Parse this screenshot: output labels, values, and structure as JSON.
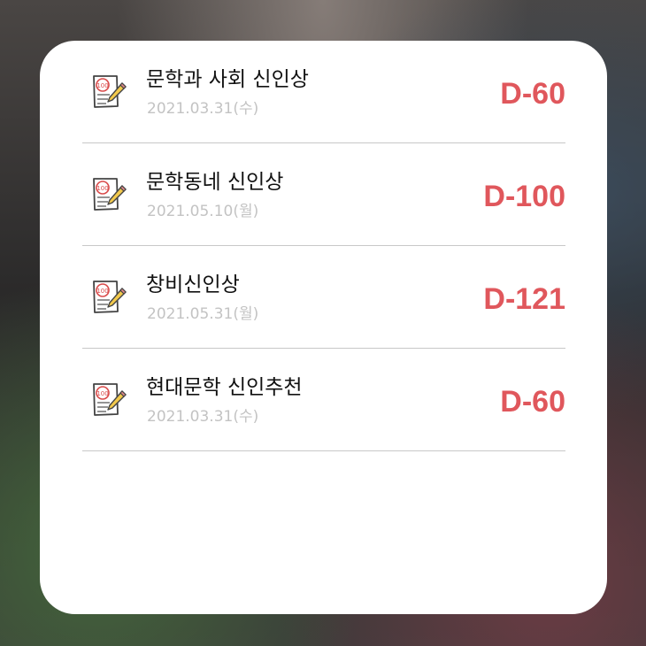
{
  "widget": {
    "accent_color": "#e0575c",
    "items": [
      {
        "title": "문학과 사회 신인상",
        "date": "2021.03.31(수)",
        "dday": "D-60",
        "icon": "exam-paper-pencil-icon"
      },
      {
        "title": "문학동네 신인상",
        "date": "2021.05.10(월)",
        "dday": "D-100",
        "icon": "exam-paper-pencil-icon"
      },
      {
        "title": "창비신인상",
        "date": "2021.05.31(월)",
        "dday": "D-121",
        "icon": "exam-paper-pencil-icon"
      },
      {
        "title": "현대문학 신인추천",
        "date": "2021.03.31(수)",
        "dday": "D-60",
        "icon": "exam-paper-pencil-icon"
      }
    ]
  }
}
